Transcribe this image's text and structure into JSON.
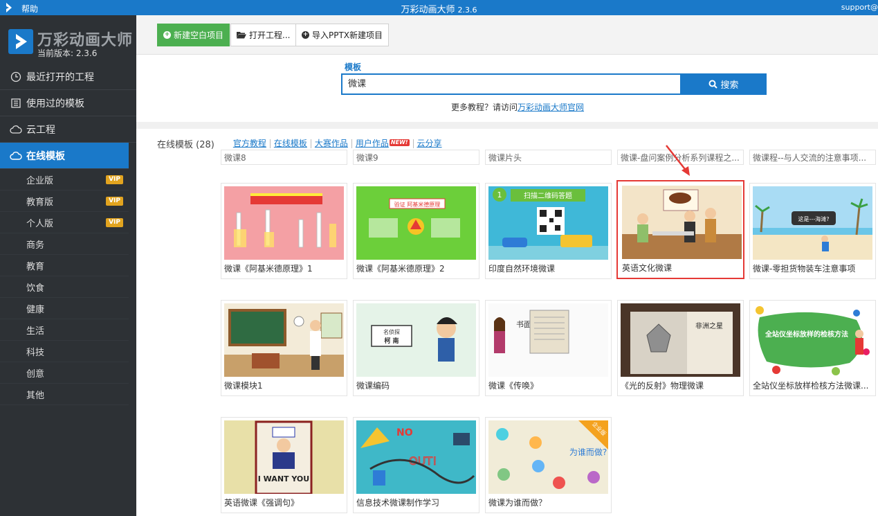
{
  "titlebar": {
    "help": "帮助",
    "title": "万彩动画大师",
    "version": "2.3.6",
    "support": "support@"
  },
  "sidebar": {
    "brand_name": "万彩动画大师",
    "brand_version": "当前版本: 2.3.6",
    "nav": [
      {
        "label": "最近打开的工程",
        "icon": "clock-icon"
      },
      {
        "label": "使用过的模板",
        "icon": "template-icon"
      },
      {
        "label": "云工程",
        "icon": "cloud-icon"
      },
      {
        "label": "在线模板",
        "icon": "cloud-icon",
        "active": true
      }
    ],
    "subitems": [
      {
        "label": "企业版",
        "vip": "VIP"
      },
      {
        "label": "教育版",
        "vip": "VIP"
      },
      {
        "label": "个人版",
        "vip": "VIP"
      },
      {
        "label": "商务"
      },
      {
        "label": "教育"
      },
      {
        "label": "饮食"
      },
      {
        "label": "健康"
      },
      {
        "label": "生活"
      },
      {
        "label": "科技"
      },
      {
        "label": "创意"
      },
      {
        "label": "其他"
      }
    ]
  },
  "toolbar": {
    "new_blank": "新建空白项目",
    "open_project": "打开工程...",
    "import_pptx": "导入PPTX新建项目"
  },
  "search": {
    "label": "模板",
    "value": "微课",
    "button": "搜索",
    "tip_prefix": "更多教程？请访问",
    "tip_link": "万彩动画大师官网"
  },
  "tabs": {
    "count_label": "在线模板 (28)",
    "links": [
      "官方教程",
      "在线模板",
      "大赛作品",
      "用户作品",
      "云分享"
    ],
    "new_badge": "NEW!"
  },
  "templates_partial": [
    "微课8",
    "微课9",
    "微课片头",
    "微课-盘问案例分析系列课程之...",
    "微课程--与人交流的注意事项..."
  ],
  "templates": [
    {
      "label": "微课《阿基米德原理》1"
    },
    {
      "label": "微课《阿基米德原理》2"
    },
    {
      "label": "印度自然环境微课"
    },
    {
      "label": "英语文化微课",
      "selected": true
    },
    {
      "label": "微课-零担货物装车注意事项"
    },
    {
      "label": "微课模块1"
    },
    {
      "label": "微课编码"
    },
    {
      "label": "微课《传唤》"
    },
    {
      "label": "《光的反射》物理微课"
    },
    {
      "label": "全站仪坐标放样检核方法微课..."
    },
    {
      "label": "英语微课《强调句》"
    },
    {
      "label": "信息技术微课制作学习"
    },
    {
      "label": "微课为谁而做？"
    }
  ],
  "thumb_text": {
    "t2_top": "验证  阿基米德原理",
    "t3_title": "扫描二维码答题",
    "t3_num": "1",
    "t5_bubble": "这是---海滩?",
    "t7_tag": "名侦探",
    "t7_name": "柯 南",
    "t8_title": "书面传唤",
    "t9_book": "非洲之星",
    "t10_title": "全站仪坐标放样的检核方法",
    "t11_text": "I WANT YOU",
    "t12_no": "NO",
    "t12_out": "OUT!",
    "t13_corner": "企业版",
    "t13_text": "为谁而做?"
  }
}
